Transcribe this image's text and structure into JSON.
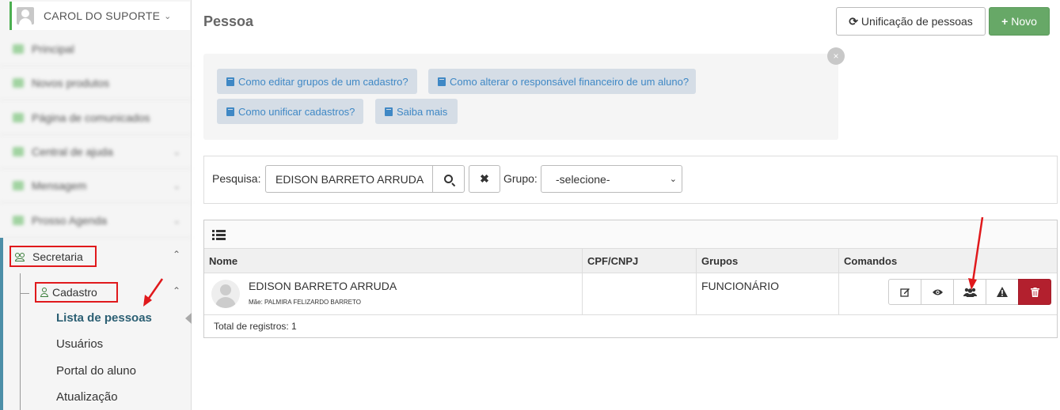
{
  "sidebar": {
    "user_name": "CAROL DO SUPORTE",
    "blurred_items": [
      "Principal",
      "Novos produtos",
      "Página de comunicados",
      "Central de ajuda",
      "Mensagem",
      "Prosso Agenda"
    ],
    "section": "Secretaria",
    "subsection": "Cadastro",
    "items": [
      "Lista de pessoas",
      "Usuários",
      "Portal do aluno",
      "Atualização"
    ]
  },
  "header": {
    "title": "Pessoa",
    "unify_label": "Unificação de pessoas",
    "new_label": "Novo"
  },
  "help": {
    "links": [
      "Como editar grupos de um cadastro?",
      "Como alterar o responsável financeiro de um aluno?",
      "Como unificar cadastros?",
      "Saiba mais"
    ],
    "close": "×"
  },
  "search": {
    "label": "Pesquisa:",
    "value": "EDISON BARRETO ARRUDA",
    "group_label": "Grupo:",
    "group_value": "-selecione-"
  },
  "table": {
    "columns": [
      "Nome",
      "CPF/CNPJ",
      "Grupos",
      "Comandos"
    ],
    "rows": [
      {
        "name": "EDISON BARRETO ARRUDA",
        "mother": "Mãe: PALMIRA FELIZARDO BARRETO",
        "cpf": "",
        "group": "FUNCIONÁRIO"
      }
    ],
    "total": "Total de registros: 1"
  },
  "colors": {
    "accent_green": "#67a867",
    "link_blue": "#3f88c5",
    "danger": "#b3202e",
    "annotation_red": "#e0191c"
  }
}
